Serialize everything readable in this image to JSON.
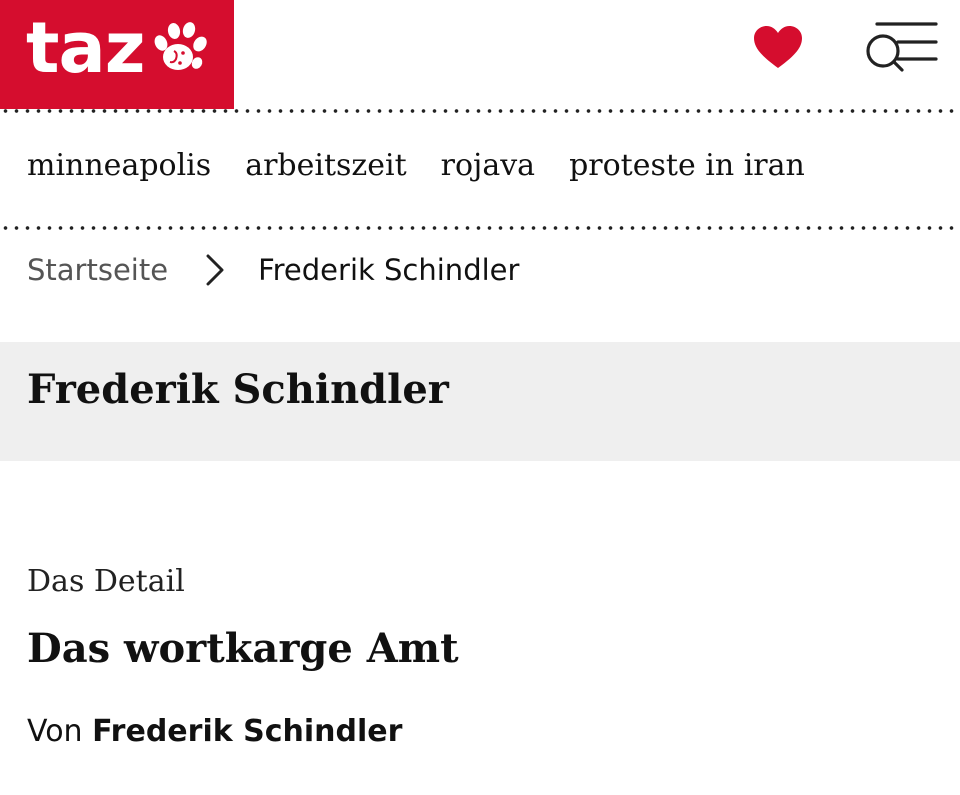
{
  "header": {
    "logo_text": "taz",
    "logo_color": "#d50d2e",
    "heart_icon": "heart-icon",
    "menu_icon": "search-menu-icon"
  },
  "topics": [
    {
      "label": "minneapolis"
    },
    {
      "label": "arbeitszeit"
    },
    {
      "label": "rojava"
    },
    {
      "label": "proteste in iran"
    }
  ],
  "breadcrumb": {
    "home": "Startseite",
    "separator_icon": "chevron-right-icon",
    "current": "Frederik Schindler"
  },
  "banner": {
    "title": "Frederik Schindler",
    "background": "#efefef"
  },
  "article": {
    "kicker": "Das Detail",
    "headline": "Das wortkarge Amt",
    "byline_prefix": "Von",
    "author": "Frederik Schindler"
  }
}
